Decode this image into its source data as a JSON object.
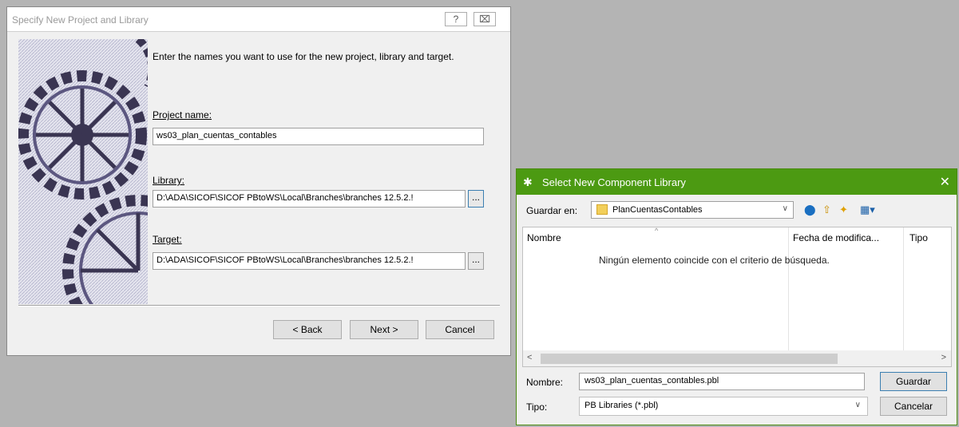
{
  "wizard": {
    "title": "Specify New Project and Library",
    "help_glyph": "?",
    "close_glyph": "⌧",
    "intro": "Enter the names you want to use for the new project, library and target.",
    "project_label": "Project name:",
    "project_value": "ws03_plan_cuentas_contables",
    "library_label": "Library:",
    "library_value": "D:\\ADA\\SICOF\\SICOF PBtoWS\\Local\\Branches\\branches 12.5.2.!",
    "target_label": "Target:",
    "target_value": "D:\\ADA\\SICOF\\SICOF PBtoWS\\Local\\Branches\\branches 12.5.2.!",
    "browse_label": "...",
    "back_label": "< Back",
    "next_label": "Next >",
    "cancel_label": "Cancel"
  },
  "save_dialog": {
    "title": "Select New Component Library",
    "close_glyph": "✕",
    "look_in_label": "Guardar en:",
    "look_in_value": "PlanCuentasContables",
    "columns": [
      "Nombre",
      "Fecha de modifica...",
      "Tipo"
    ],
    "empty_message": "Ningún elemento coincide con el criterio de búsqueda.",
    "filename_label": "Nombre:",
    "filename_value": "ws03_plan_cuentas_contables.pbl",
    "filetype_label": "Tipo:",
    "filetype_value": "PB Libraries (*.pbl)",
    "save_label": "Guardar",
    "cancel_label": "Cancelar"
  },
  "colors": {
    "titlebar_green": "#4c9a12",
    "dialog_bg": "#f0f0f0",
    "desktop_gray": "#b4b4b4"
  }
}
